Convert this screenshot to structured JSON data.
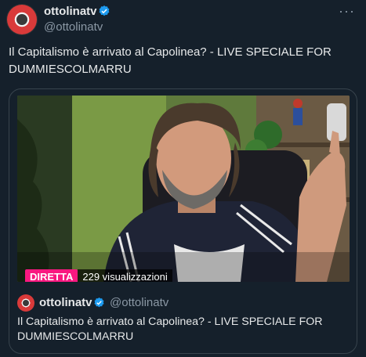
{
  "tweet": {
    "author_name": "ottolinatv",
    "author_handle": "@ottolinatv",
    "more_label": "···",
    "text": "Il Capitalismo è arrivato al Capolinea? - LIVE SPECIALE FOR DUMMIESCOLMARRU"
  },
  "quoted": {
    "author_name": "ottolinatv",
    "author_handle": "@ottolinatv",
    "text": "Il Capitalismo è arrivato al Capolinea? - LIVE SPECIALE FOR DUMMIESCOLMARRU",
    "media": {
      "live_label": "DIRETTA",
      "views_label": "229 visualizzazioni"
    }
  },
  "colors": {
    "background": "#15202b",
    "verified": "#1d9bf0",
    "live_badge": "#f91880",
    "secondary_text": "#8b98a5"
  },
  "icons": [
    "verified-badge-icon",
    "more-options-icon"
  ]
}
